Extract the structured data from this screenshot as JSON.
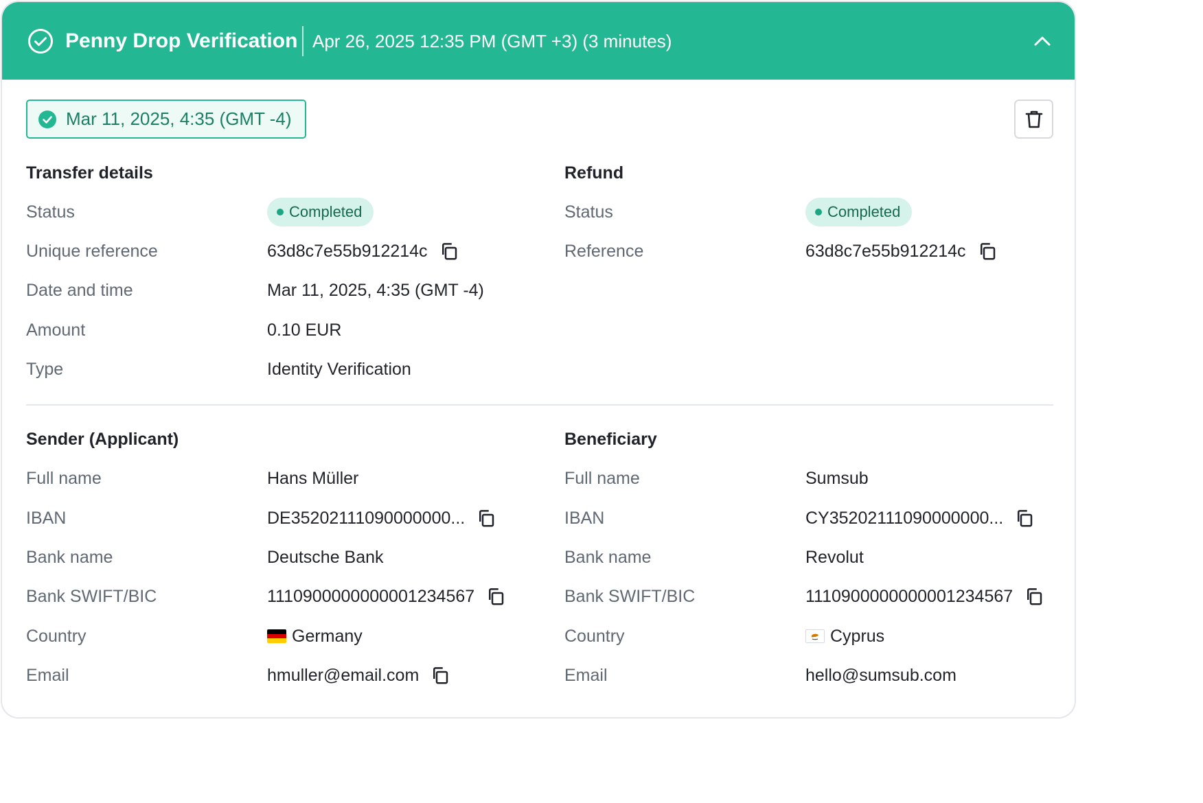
{
  "header": {
    "title": "Penny Drop Verification",
    "subtitle": "Apr 26, 2025 12:35 PM (GMT +3) (3 minutes)",
    "icon": "check-circle-icon",
    "collapse_icon": "chevron-up-icon"
  },
  "date_chip": {
    "label": "Mar 11, 2025, 4:35 (GMT -4)",
    "icon": "check-filled-icon"
  },
  "delete_icon": "trash-icon",
  "transfer": {
    "title": "Transfer details",
    "status_label": "Status",
    "status": "Completed",
    "reference_label": "Unique reference",
    "reference": "63d8c7e55b912214c",
    "datetime_label": "Date and time",
    "datetime": "Mar 11, 2025, 4:35 (GMT -4)",
    "amount_label": "Amount",
    "amount": "0.10 EUR",
    "type_label": "Type",
    "type": "Identity Verification"
  },
  "refund": {
    "title": "Refund",
    "status_label": "Status",
    "status": "Completed",
    "reference_label": "Reference",
    "reference": "63d8c7e55b912214c"
  },
  "sender": {
    "title": "Sender (Applicant)",
    "full_name_label": "Full name",
    "full_name": "Hans Müller",
    "iban_label": "IBAN",
    "iban": "DE35202111090000000...",
    "bank_name_label": "Bank name",
    "bank_name": "Deutsche Bank",
    "swift_label": "Bank SWIFT/BIC",
    "swift": "1110900000000001234567",
    "country_label": "Country",
    "country": "Germany",
    "email_label": "Email",
    "email": "hmuller@email.com"
  },
  "beneficiary": {
    "title": "Beneficiary",
    "full_name_label": "Full name",
    "full_name": "Sumsub",
    "iban_label": "IBAN",
    "iban": "CY35202111090000000...",
    "bank_name_label": "Bank name",
    "bank_name": "Revolut",
    "swift_label": "Bank SWIFT/BIC",
    "swift": "1110900000000001234567",
    "country_label": "Country",
    "country": "Cyprus",
    "email_label": "Email",
    "email": "hello@sumsub.com"
  },
  "colors": {
    "brand": "#24b794",
    "badge_bg": "#d5f3ea",
    "badge_text": "#15694f"
  }
}
